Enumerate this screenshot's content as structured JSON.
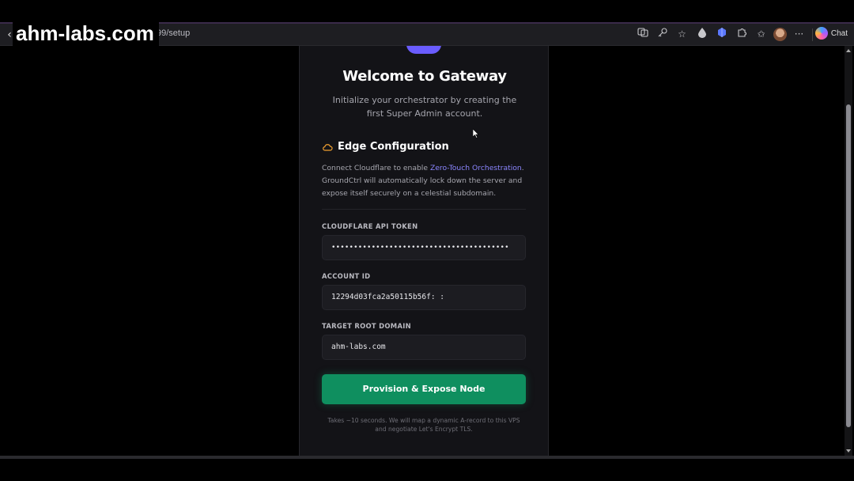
{
  "browser": {
    "watermark": "ahm-labs.com",
    "url": "99/setup",
    "chat_label": "Chat",
    "icons": [
      "back-arrow-icon",
      "translate-icon",
      "key-icon",
      "star-icon",
      "droplet-icon",
      "extension-blue-icon",
      "puzzle-icon",
      "favorites-icon",
      "profile-avatar",
      "more-icon",
      "copilot-icon"
    ]
  },
  "card": {
    "title": "Welcome to Gateway",
    "subtitle": "Initialize your orchestrator by creating the first Super Admin account.",
    "section": {
      "icon": "cloud-icon",
      "title": "Edge Configuration",
      "desc_prefix": "Connect Cloudflare to enable ",
      "desc_link": "Zero-Touch Orchestration",
      "desc_suffix": ". GroundCtrl will automatically lock down the server and expose itself securely on a celestial subdomain."
    },
    "fields": {
      "token_label": "CLOUDFLARE API TOKEN",
      "token_value": "••••••••••••••••••••••••••••••••••••••••",
      "account_label": "ACCOUNT ID",
      "account_value": "12294d03fca2a50115b56f:          :",
      "domain_label": "TARGET ROOT DOMAIN",
      "domain_value": "ahm-labs.com"
    },
    "cta_label": "Provision & Expose Node",
    "note": "Takes ~10 seconds. We will map a dynamic A-record to this VPS and negotiate Let's Encrypt TLS."
  },
  "colors": {
    "accent": "#6a5cff",
    "link": "#8b86ff",
    "cta": "#0f8f5f",
    "card_bg": "#131317"
  }
}
